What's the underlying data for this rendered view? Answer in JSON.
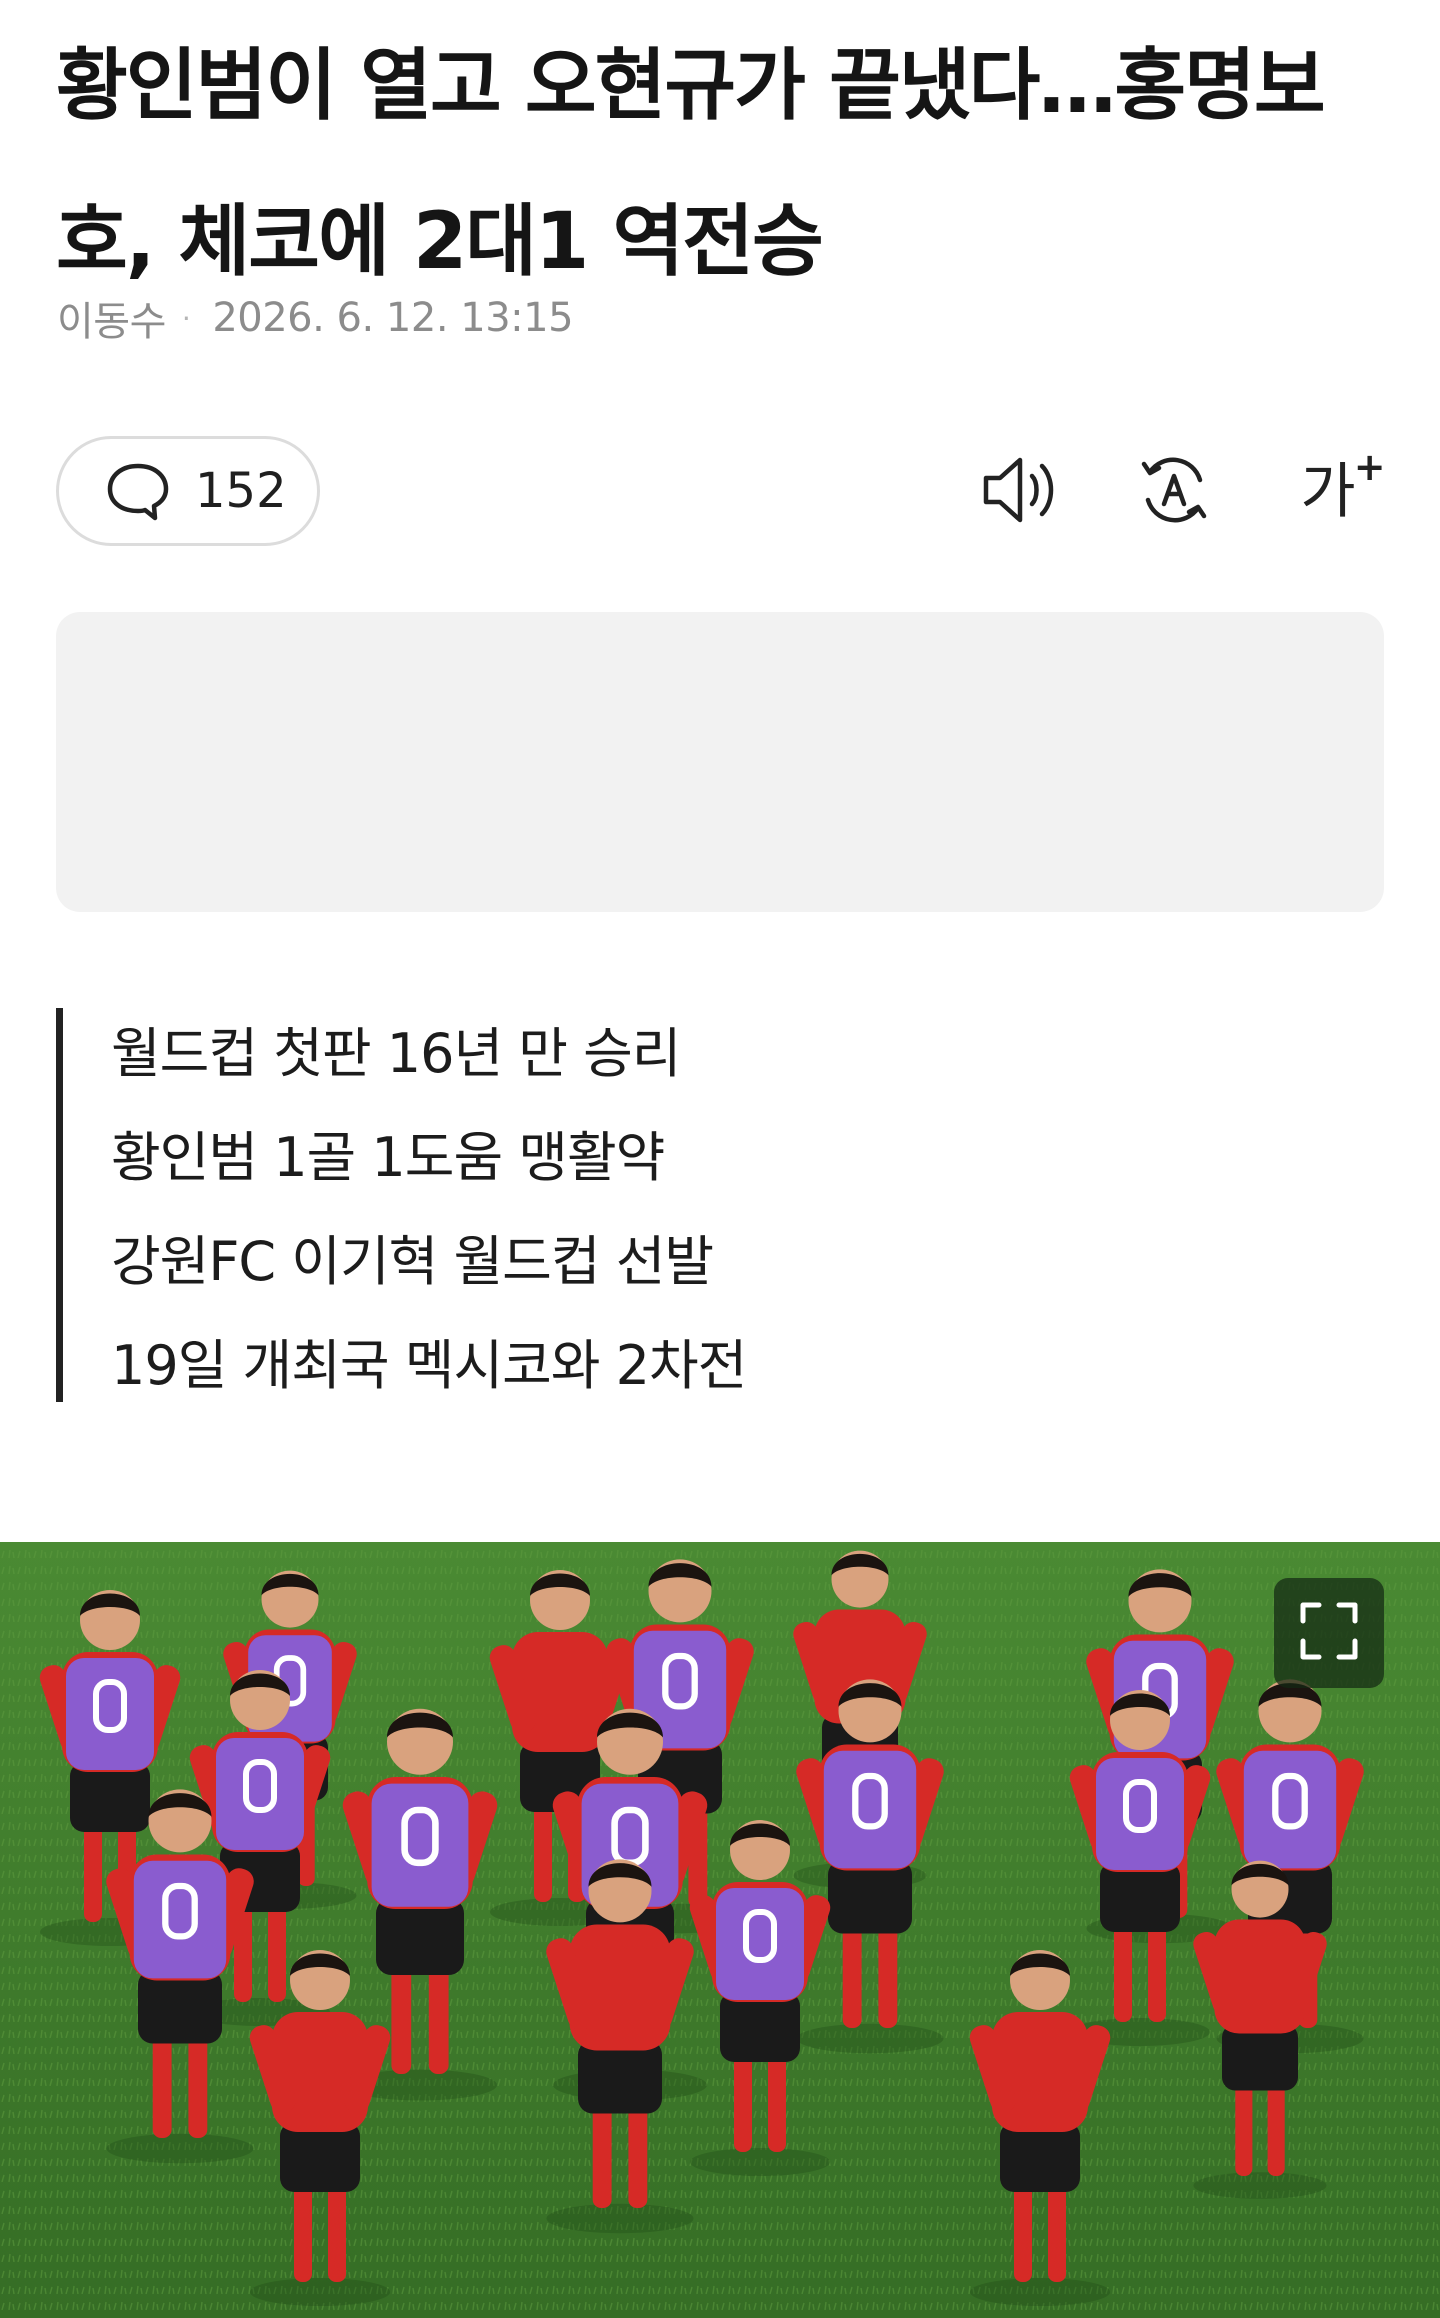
{
  "article": {
    "title": "황인범이 열고 오현규가 끝냈다…홍명보호, 체코에 2대1 역전승",
    "author": "이동수",
    "meta_separator": "·",
    "date": "2026. 6. 12. 13:15"
  },
  "toolbar": {
    "comment_count": "152",
    "comment_icon": "speech-bubble-icon",
    "speaker_icon": "speaker-icon",
    "translate_icon": "translate-icon",
    "font_size_label": "가",
    "font_size_plus": "+"
  },
  "summary": [
    "월드컵 첫판 16년 만 승리",
    "황인범 1골 1도움 맹활약",
    "강원FC 이기혁 월드컵 선발",
    "19일 개최국 멕시코와 2차전"
  ],
  "photo": {
    "fullscreen_icon": "fullscreen-icon",
    "colors": {
      "pitch": "#3f7a2c",
      "jersey": "#d62a26",
      "bib": "#8a5ccf",
      "shorts": "#1a1a1a"
    }
  },
  "colors": {
    "text": "#1a1a1a",
    "meta": "#8c8c8c",
    "border": "#dcdcdc",
    "ad_background": "#f2f2f2",
    "quote_bar": "#222222"
  }
}
